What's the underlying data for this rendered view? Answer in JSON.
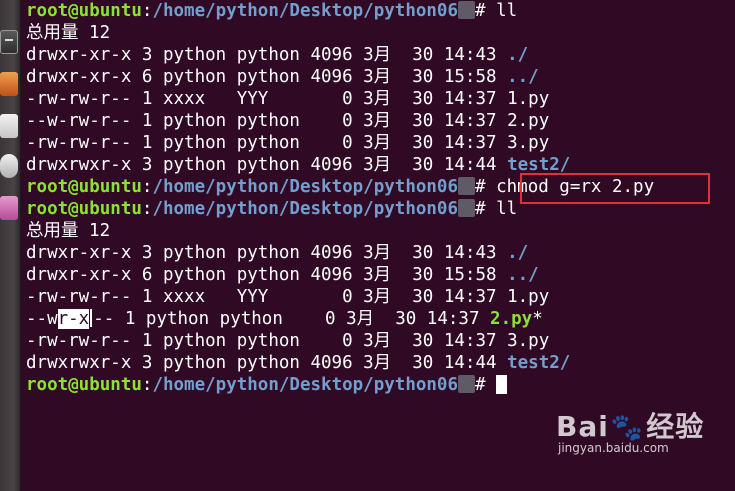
{
  "terminal": {
    "user_host": "root@ubuntu",
    "path": "/home/python/Desktop/python06",
    "hash": "#",
    "total_line": "总用量 12",
    "cmd1": " ll",
    "cmd2": " chmod g=rx 2.py",
    "cmd3": " ll",
    "listing1": [
      {
        "perm": "drwxr-xr-x",
        "links": "3",
        "owner": "python",
        "group": "python",
        "size": "4096",
        "month": "3月",
        "day": "30",
        "time": "14:43",
        "name": "./",
        "name_style": "dir"
      },
      {
        "perm": "drwxr-xr-x",
        "links": "6",
        "owner": "python",
        "group": "python",
        "size": "4096",
        "month": "3月",
        "day": "30",
        "time": "15:58",
        "name": "../",
        "name_style": "dir"
      },
      {
        "perm": "-rw-rw-r--",
        "links": "1",
        "owner": "xxxx",
        "group": "YYY",
        "size": "0",
        "month": "3月",
        "day": "30",
        "time": "14:37",
        "name": "1.py",
        "name_style": "plain"
      },
      {
        "perm": "--w-rw-r--",
        "links": "1",
        "owner": "python",
        "group": "python",
        "size": "0",
        "month": "3月",
        "day": "30",
        "time": "14:37",
        "name": "2.py",
        "name_style": "plain"
      },
      {
        "perm": "-rw-rw-r--",
        "links": "1",
        "owner": "python",
        "group": "python",
        "size": "0",
        "month": "3月",
        "day": "30",
        "time": "14:37",
        "name": "3.py",
        "name_style": "plain"
      },
      {
        "perm": "drwxrwxr-x",
        "links": "3",
        "owner": "python",
        "group": "python",
        "size": "4096",
        "month": "3月",
        "day": "30",
        "time": "14:44",
        "name": "test2/",
        "name_style": "dir"
      }
    ],
    "listing2": [
      {
        "perm": "drwxr-xr-x",
        "links": "3",
        "owner": "python",
        "group": "python",
        "size": "4096",
        "month": "3月",
        "day": "30",
        "time": "14:43",
        "name": "./",
        "name_style": "dir"
      },
      {
        "perm": "drwxr-xr-x",
        "links": "6",
        "owner": "python",
        "group": "python",
        "size": "4096",
        "month": "3月",
        "day": "30",
        "time": "15:58",
        "name": "../",
        "name_style": "dir"
      },
      {
        "perm": "-rw-rw-r--",
        "links": "1",
        "owner": "xxxx",
        "group": "YYY",
        "size": "0",
        "month": "3月",
        "day": "30",
        "time": "14:37",
        "name": "1.py",
        "name_style": "plain"
      },
      {
        "perm": "--wr-xr--",
        "links": "1",
        "owner": "python",
        "group": "python",
        "size": "0",
        "month": "3月",
        "day": "30",
        "time": "14:37",
        "name": "2.py*",
        "name_style": "exec"
      },
      {
        "perm": "-rw-rw-r--",
        "links": "1",
        "owner": "python",
        "group": "python",
        "size": "0",
        "month": "3月",
        "day": "30",
        "time": "14:37",
        "name": "3.py",
        "name_style": "plain"
      },
      {
        "perm": "drwxrwxr-x",
        "links": "3",
        "owner": "python",
        "group": "python",
        "size": "4096",
        "month": "3月",
        "day": "30",
        "time": "14:44",
        "name": "test2/",
        "name_style": "dir"
      }
    ]
  },
  "watermark": {
    "logo": "Bai",
    "logo_tail": "经验",
    "site": "jingyan.baidu.com"
  },
  "colors": {
    "background": "#300a24",
    "user": "#8ae234",
    "path": "#729fcf",
    "highlight_box": "#e0303a"
  },
  "icons": [
    "terminal-icon",
    "impress-icon",
    "calc-icon",
    "settings-icon",
    "help-icon",
    "baidu-paw-icon"
  ]
}
